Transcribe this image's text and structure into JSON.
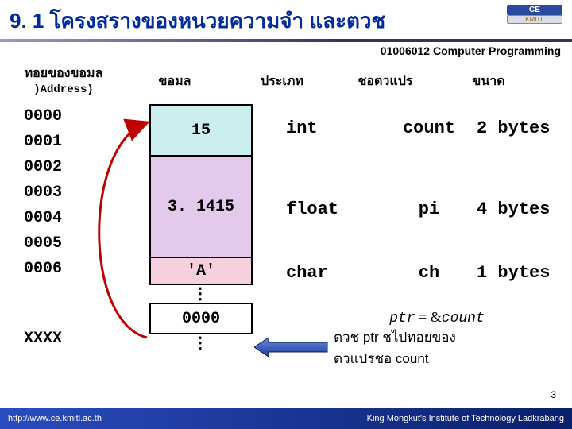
{
  "header": {
    "title": "9. 1 โครงสรางของหนวยความจำ และตวช",
    "course": "01006012 Computer Programming",
    "logo_top": "CE",
    "logo_bot": "KMITL"
  },
  "columns": {
    "addr_label": "ทอยของขอมล",
    "addr_sub": ")Address)",
    "data_label": "ขอมล",
    "type_label": "ประเภท",
    "var_label": "ชอตวแปร",
    "size_label": "ขนาด"
  },
  "addresses": [
    "0000",
    "0001",
    "0002",
    "0003",
    "0004",
    "0005",
    "0006"
  ],
  "xxxx": "XXXX",
  "cells": {
    "int_val": "15",
    "float_val": "3. 1415",
    "char_val": "'A'",
    "ptr_val": "0000"
  },
  "rows": [
    {
      "type": "int",
      "var": "count",
      "size": "2 bytes"
    },
    {
      "type": "float",
      "var": "pi",
      "size": "4 bytes"
    },
    {
      "type": "char",
      "var": "ch",
      "size": "1 bytes"
    }
  ],
  "note": {
    "line1_pre": "ptr",
    "line1_mid": " = &",
    "line1_post": "count",
    "line2": "ตวช ptr ชไปทอยของ",
    "line3": "ตวแปรชอ count"
  },
  "dots": "⋮",
  "footer": {
    "left": "http://www.ce.kmitl.ac.th",
    "right": "King Mongkut's Institute of Technology Ladkrabang"
  },
  "page": "3"
}
